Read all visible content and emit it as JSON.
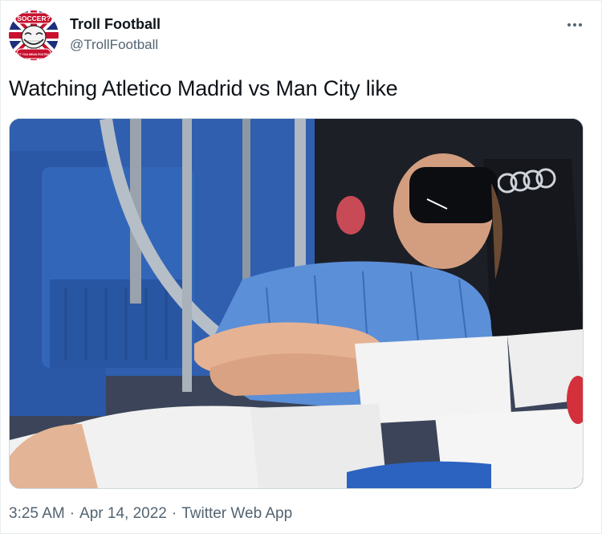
{
  "tweet": {
    "display_name": "Troll Football",
    "handle": "@TrollFootball",
    "text": "Watching Atletico Madrid vs Man City like",
    "time": "3:25 AM",
    "date": "Apr 14, 2022",
    "source": "Twitter Web App",
    "separator": "·"
  },
  "avatar": {
    "badge_top": "SOCCER?",
    "badge_bottom": "DON'T YOU MEAN FOOTBALL?"
  },
  "icons": {
    "more": "more-horizontal-icon"
  },
  "colors": {
    "text_primary": "#0f1419",
    "text_secondary": "#536471",
    "border": "#e6ecf0"
  }
}
